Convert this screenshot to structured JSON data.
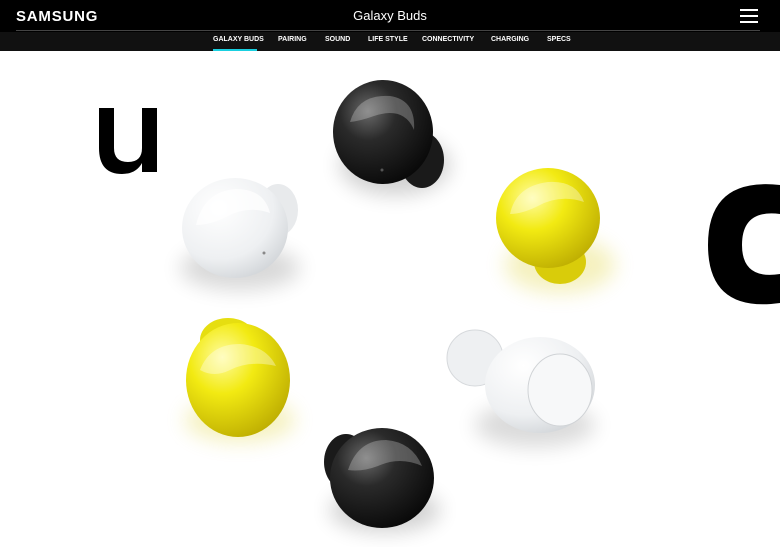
{
  "header": {
    "logo": "SAMSUNG",
    "title": "Galaxy Buds",
    "menu_icon": "hamburger-menu-icon"
  },
  "subnav": {
    "items": [
      {
        "label": "GALAXY BUDS",
        "active": true
      },
      {
        "label": "PAIRING"
      },
      {
        "label": "SOUND"
      },
      {
        "label": "LIFE STYLE"
      },
      {
        "label": "CONNECTIVITY"
      },
      {
        "label": "CHARGING"
      },
      {
        "label": "SPECS"
      }
    ],
    "active_color": "#1ad0e0"
  },
  "hero": {
    "big_letters": [
      "u",
      "c"
    ],
    "earbuds": [
      {
        "color": "black"
      },
      {
        "color": "yellow"
      },
      {
        "color": "white"
      },
      {
        "color": "black"
      },
      {
        "color": "yellow"
      },
      {
        "color": "white"
      }
    ]
  }
}
